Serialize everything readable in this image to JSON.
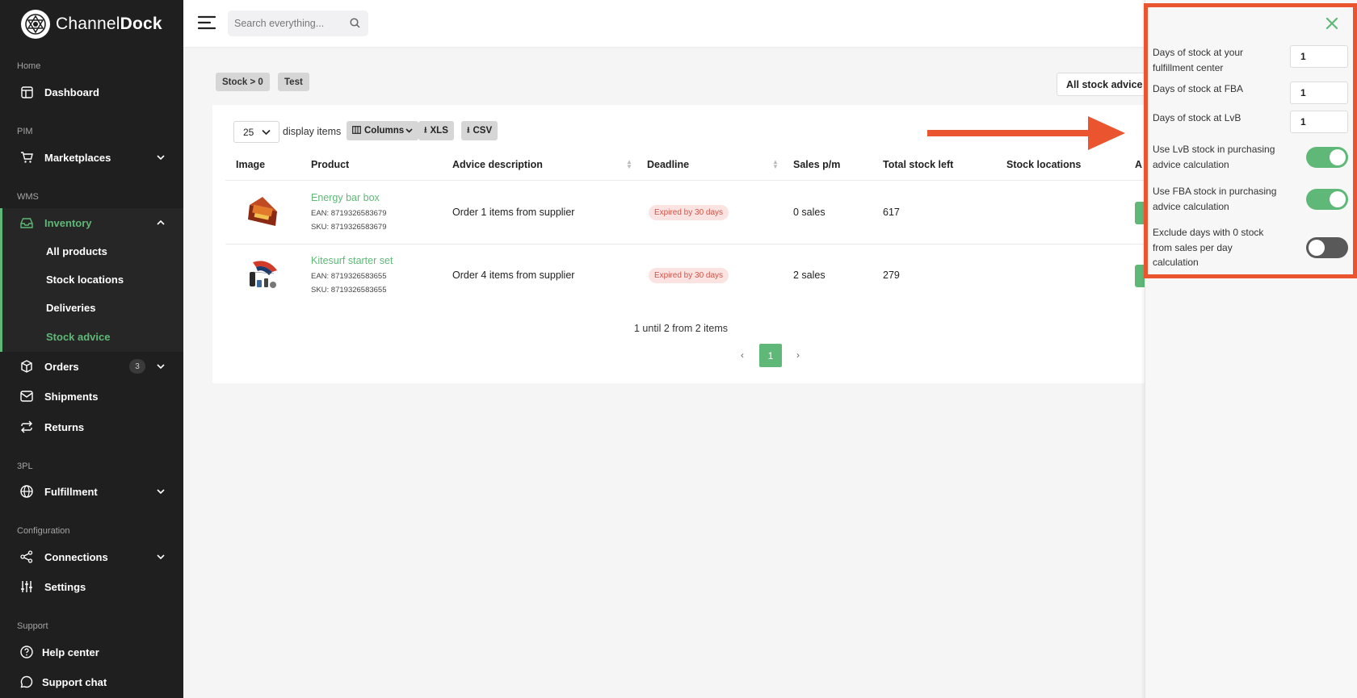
{
  "brand": {
    "name_prefix": "Channel",
    "name_bold": "Dock"
  },
  "sidebar": {
    "sections": {
      "home": "Home",
      "pim": "PIM",
      "wms": "WMS",
      "tpl": "3PL",
      "config": "Configuration",
      "support": "Support"
    },
    "items": {
      "dashboard": "Dashboard",
      "marketplaces": "Marketplaces",
      "inventory": "Inventory",
      "orders": "Orders",
      "orders_badge": "3",
      "shipments": "Shipments",
      "returns": "Returns",
      "fulfillment": "Fulfillment",
      "connections": "Connections",
      "settings": "Settings",
      "help": "Help center",
      "chat": "Support chat"
    },
    "inventory_sub": [
      "All products",
      "Stock locations",
      "Deliveries",
      "Stock advice"
    ],
    "accent": "#5fb877"
  },
  "search": {
    "placeholder": "Search everything..."
  },
  "filters": {
    "chips": [
      "Stock > 0",
      "Test"
    ],
    "all_stock": "All stock advice"
  },
  "table_toolbar": {
    "per_page": "25",
    "display_items": "display items",
    "columns": "Columns",
    "xls": "XLS",
    "csv": "CSV"
  },
  "table": {
    "headers": [
      "Image",
      "Product",
      "Advice description",
      "Deadline",
      "Sales p/m",
      "Total stock left",
      "Stock locations",
      "A"
    ],
    "rows": [
      {
        "product": "Energy bar box",
        "ean": "EAN: 8719326583679",
        "sku": "SKU: 8719326583679",
        "advice": "Order 1 items from supplier",
        "deadline": "Expired by 30 days",
        "sales": "0 sales",
        "stock": "617"
      },
      {
        "product": "Kitesurf starter set",
        "ean": "EAN: 8719326583655",
        "sku": "SKU: 8719326583655",
        "advice": "Order 4 items from supplier",
        "deadline": "Expired by 30 days",
        "sales": "2 sales",
        "stock": "279"
      }
    ]
  },
  "pagination": {
    "info": "1 until 2 from 2 items",
    "prev": "‹",
    "current": "1",
    "next": "›"
  },
  "panel": {
    "fields": [
      {
        "label": "Days of stock at your fulfillment center",
        "value": "1"
      },
      {
        "label": "Days of stock at FBA",
        "value": "1"
      },
      {
        "label": "Days of stock at LvB",
        "value": "1"
      }
    ],
    "toggles": [
      {
        "label": "Use LvB stock in purchasing advice calculation",
        "on": true
      },
      {
        "label": "Use FBA stock in purchasing advice calculation",
        "on": true
      },
      {
        "label": "Exclude days with 0 stock from sales per day calculation",
        "on": false
      }
    ],
    "highlight_color": "#ea5530"
  }
}
